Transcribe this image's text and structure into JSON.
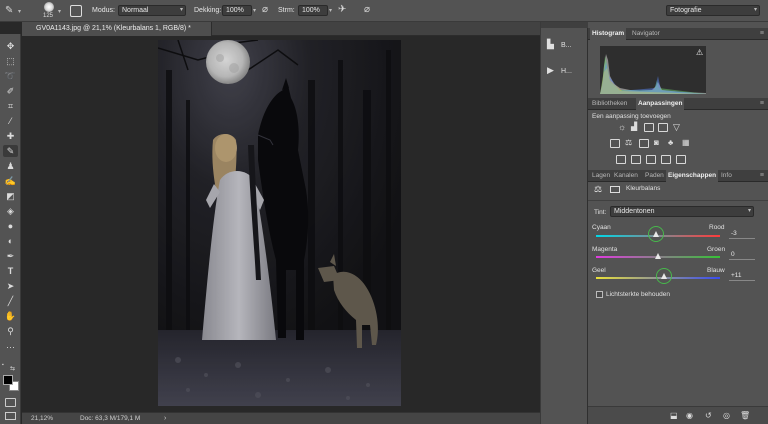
{
  "options_bar": {
    "brush_size": "125",
    "mode_label": "Modus:",
    "mode_value": "Normaal",
    "opacity_label": "Dekking:",
    "opacity_value": "100%",
    "flow_label": "Strm:",
    "flow_value": "100%",
    "workspace": "Fotografie"
  },
  "document": {
    "tab_title": "GV0A1143.jpg @ 21,1% (Kleurbalans 1, RGB/8) *"
  },
  "status": {
    "zoom": "21,12%",
    "doc_info": "Doc: 63,3 M/179,1 M"
  },
  "mini_panels": [
    {
      "label": "B..."
    },
    {
      "label": "H..."
    }
  ],
  "histogram_panel": {
    "tabs": [
      "Histogram",
      "Navigator"
    ]
  },
  "adjustments_panel": {
    "tabs": [
      "Bibliotheken",
      "Aanpassingen"
    ],
    "heading": "Een aanpassing toevoegen"
  },
  "properties_panel": {
    "tabs": [
      "Lagen",
      "Kanalen",
      "Paden",
      "Eigenschappen",
      "Info"
    ],
    "title": "Kleurbalans",
    "tone_label": "Tint:",
    "tone_value": "Middentonen",
    "sliders": [
      {
        "left": "Cyaan",
        "right": "Rood",
        "value": "-3",
        "position": 0.485
      },
      {
        "left": "Magenta",
        "right": "Groen",
        "value": "0",
        "position": 0.5
      },
      {
        "left": "Geel",
        "right": "Blauw",
        "value": "+11",
        "position": 0.555
      }
    ],
    "preserve_label": "Lichtsterkte behouden"
  },
  "colors": {
    "accent_green": "#47b84b",
    "panel_bg": "#535353"
  }
}
